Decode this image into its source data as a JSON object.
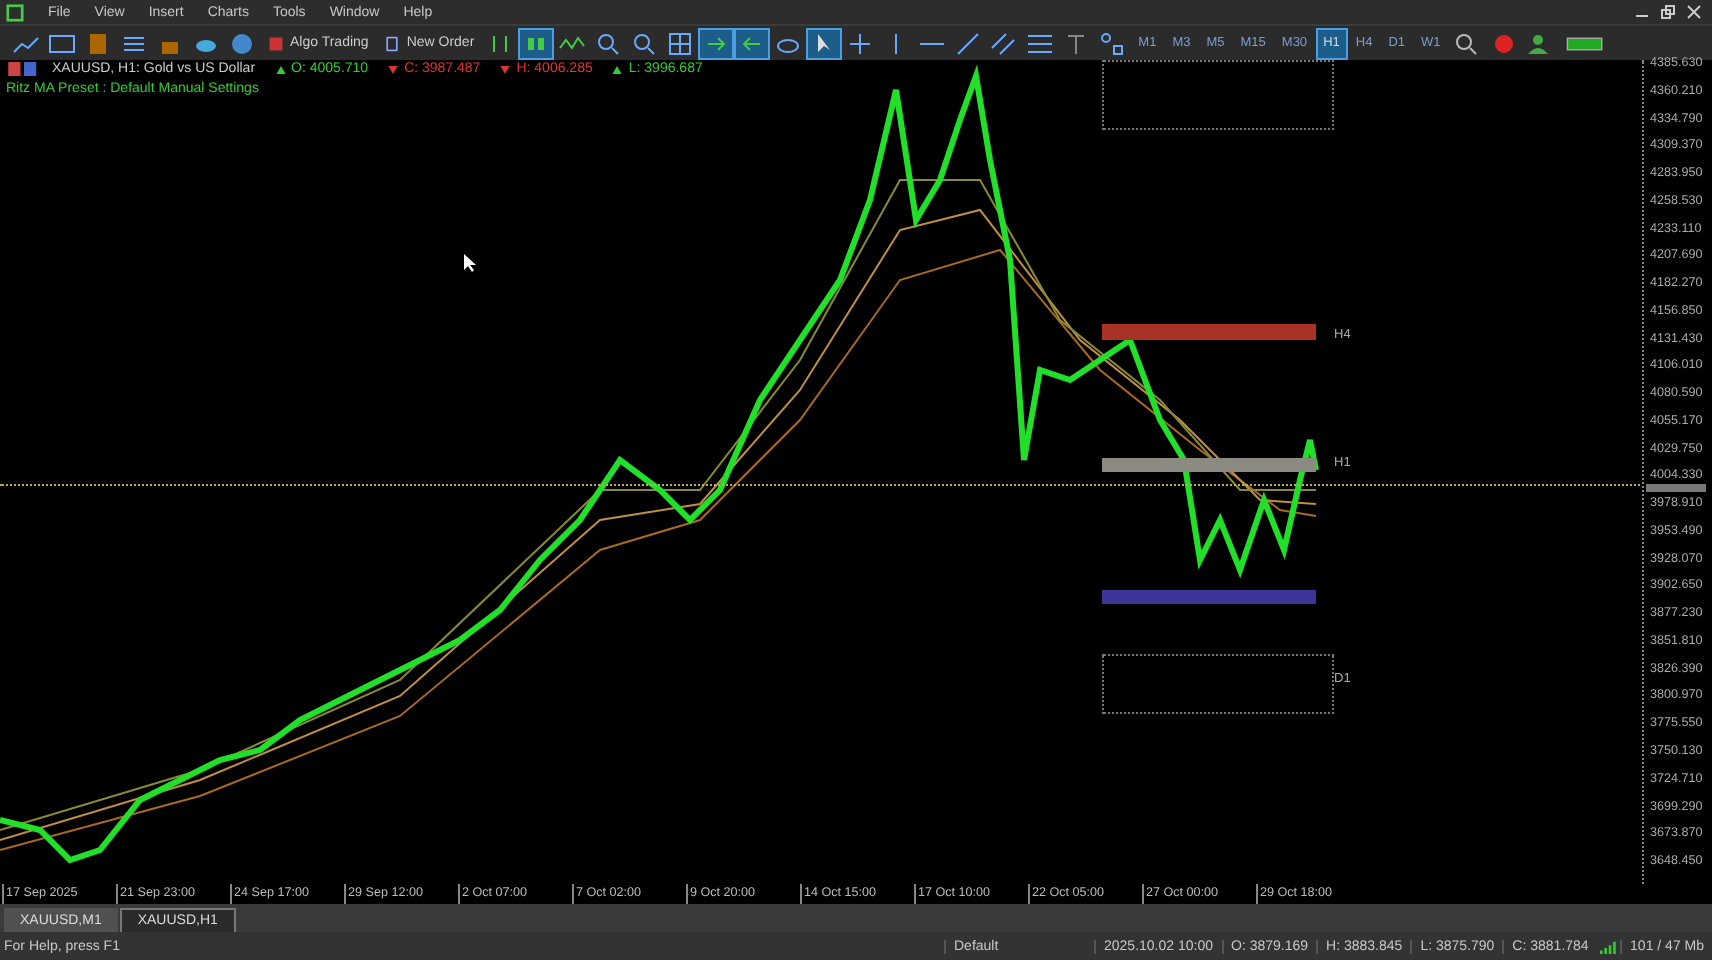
{
  "menu": [
    "File",
    "View",
    "Insert",
    "Charts",
    "Tools",
    "Window",
    "Help"
  ],
  "toolbar": {
    "buttons": [
      {
        "label": "Algo Trading",
        "kind": "algo"
      },
      {
        "label": "New Order",
        "kind": "order"
      }
    ],
    "timeframes": [
      {
        "label": "M1",
        "selected": false
      },
      {
        "label": "M3",
        "selected": false
      },
      {
        "label": "M5",
        "selected": false
      },
      {
        "label": "M15",
        "selected": false
      },
      {
        "label": "M30",
        "selected": false
      },
      {
        "label": "H1",
        "selected": true
      },
      {
        "label": "H4",
        "selected": false
      },
      {
        "label": "D1",
        "selected": false
      },
      {
        "label": "W1",
        "selected": false
      }
    ]
  },
  "chart": {
    "title": "XAUUSD, H1:  Gold vs US Dollar",
    "quotes": [
      {
        "label": "O: 4005.710",
        "kind": "rise"
      },
      {
        "label": "C: 3987.487",
        "kind": "fall"
      },
      {
        "label": "H: 4006.285",
        "kind": "fall"
      },
      {
        "label": "L: 3996.687",
        "kind": "rise"
      }
    ],
    "indicator_label": "Ritz MA Preset : Default Manual Settings",
    "zones": [
      {
        "kind": "outline"
      },
      {
        "kind": "filled",
        "color": "#a83224",
        "label": "H4"
      },
      {
        "kind": "filled",
        "color": "#8a8a80",
        "label": "H1"
      },
      {
        "kind": "filled",
        "color": "#3c3497"
      },
      {
        "kind": "outline",
        "label": "D1"
      }
    ],
    "price_axis": [
      "4385.630",
      "4360.210",
      "4334.790",
      "4309.370",
      "4283.950",
      "4258.530",
      "4233.110",
      "4207.690",
      "4182.270",
      "4156.850",
      "4131.430",
      "4106.010",
      "4080.590",
      "4055.170",
      "4029.750",
      "4004.330",
      "3978.910",
      "3953.490",
      "3928.070",
      "3902.650",
      "3877.230",
      "3851.810",
      "3826.390",
      "3800.970",
      "3775.550",
      "3750.130",
      "3724.710",
      "3699.290",
      "3673.870",
      "3648.450"
    ],
    "time_axis": [
      "17 Sep 2025",
      "21 Sep 23:00",
      "24 Sep 17:00",
      "29 Sep 12:00",
      "2 Oct 07:00",
      "7 Oct 02:00",
      "9 Oct 20:00",
      "14 Oct 15:00",
      "17 Oct 10:00",
      "22 Oct 05:00",
      "27 Oct 00:00",
      "29 Oct 18:00"
    ]
  },
  "tabs": [
    {
      "label": "XAUUSD,M1",
      "selected": false
    },
    {
      "label": "XAUUSD,H1",
      "selected": true
    }
  ],
  "status_bar": {
    "help": "For Help, press F1",
    "profile": "Default",
    "fields": [
      "2025.10.02 10:00",
      "O: 3879.169",
      "H: 3883.845",
      "L: 3875.790",
      "C: 3881.784"
    ],
    "memory": "101 / 47 Mb"
  }
}
